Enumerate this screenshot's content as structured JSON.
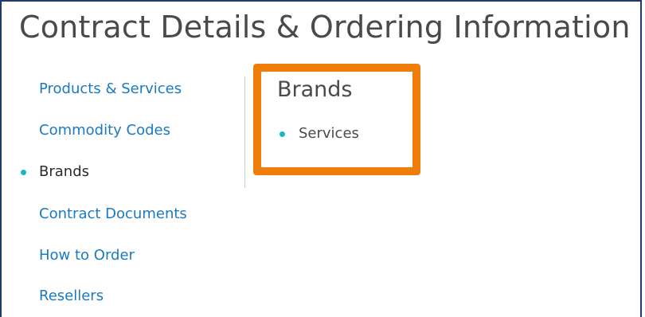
{
  "page": {
    "title": "Contract Details & Ordering Information"
  },
  "sidebar": {
    "items": [
      {
        "label": "Products & Services",
        "active": false
      },
      {
        "label": "Commodity Codes",
        "active": false
      },
      {
        "label": "Brands",
        "active": true
      },
      {
        "label": "Contract Documents",
        "active": false
      },
      {
        "label": "How to Order",
        "active": false
      },
      {
        "label": "Resellers",
        "active": false
      }
    ]
  },
  "main": {
    "heading": "Brands",
    "brands": [
      "Services"
    ]
  },
  "colors": {
    "link": "#1a7ac0",
    "bullet": "#1bb5c4",
    "highlight": "#ee7d0a",
    "frame": "#1f3a6e",
    "text": "#4a4a4a"
  }
}
